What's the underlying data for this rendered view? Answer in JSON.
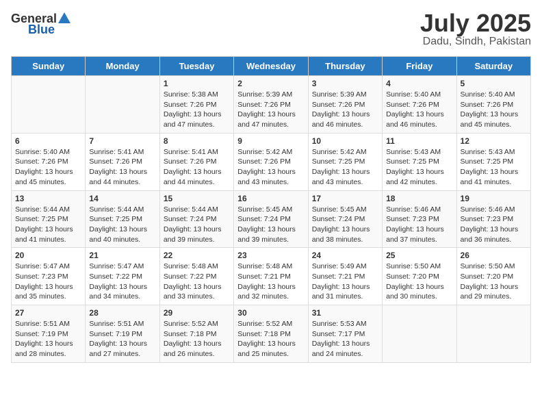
{
  "logo": {
    "general": "General",
    "blue": "Blue"
  },
  "title": "July 2025",
  "subtitle": "Dadu, Sindh, Pakistan",
  "weekdays": [
    "Sunday",
    "Monday",
    "Tuesday",
    "Wednesday",
    "Thursday",
    "Friday",
    "Saturday"
  ],
  "weeks": [
    [
      {
        "day": "",
        "info": ""
      },
      {
        "day": "",
        "info": ""
      },
      {
        "day": "1",
        "sunrise": "5:38 AM",
        "sunset": "7:26 PM",
        "daylight": "13 hours and 47 minutes."
      },
      {
        "day": "2",
        "sunrise": "5:39 AM",
        "sunset": "7:26 PM",
        "daylight": "13 hours and 47 minutes."
      },
      {
        "day": "3",
        "sunrise": "5:39 AM",
        "sunset": "7:26 PM",
        "daylight": "13 hours and 46 minutes."
      },
      {
        "day": "4",
        "sunrise": "5:40 AM",
        "sunset": "7:26 PM",
        "daylight": "13 hours and 46 minutes."
      },
      {
        "day": "5",
        "sunrise": "5:40 AM",
        "sunset": "7:26 PM",
        "daylight": "13 hours and 45 minutes."
      }
    ],
    [
      {
        "day": "6",
        "sunrise": "5:40 AM",
        "sunset": "7:26 PM",
        "daylight": "13 hours and 45 minutes."
      },
      {
        "day": "7",
        "sunrise": "5:41 AM",
        "sunset": "7:26 PM",
        "daylight": "13 hours and 44 minutes."
      },
      {
        "day": "8",
        "sunrise": "5:41 AM",
        "sunset": "7:26 PM",
        "daylight": "13 hours and 44 minutes."
      },
      {
        "day": "9",
        "sunrise": "5:42 AM",
        "sunset": "7:26 PM",
        "daylight": "13 hours and 43 minutes."
      },
      {
        "day": "10",
        "sunrise": "5:42 AM",
        "sunset": "7:25 PM",
        "daylight": "13 hours and 43 minutes."
      },
      {
        "day": "11",
        "sunrise": "5:43 AM",
        "sunset": "7:25 PM",
        "daylight": "13 hours and 42 minutes."
      },
      {
        "day": "12",
        "sunrise": "5:43 AM",
        "sunset": "7:25 PM",
        "daylight": "13 hours and 41 minutes."
      }
    ],
    [
      {
        "day": "13",
        "sunrise": "5:44 AM",
        "sunset": "7:25 PM",
        "daylight": "13 hours and 41 minutes."
      },
      {
        "day": "14",
        "sunrise": "5:44 AM",
        "sunset": "7:25 PM",
        "daylight": "13 hours and 40 minutes."
      },
      {
        "day": "15",
        "sunrise": "5:44 AM",
        "sunset": "7:24 PM",
        "daylight": "13 hours and 39 minutes."
      },
      {
        "day": "16",
        "sunrise": "5:45 AM",
        "sunset": "7:24 PM",
        "daylight": "13 hours and 39 minutes."
      },
      {
        "day": "17",
        "sunrise": "5:45 AM",
        "sunset": "7:24 PM",
        "daylight": "13 hours and 38 minutes."
      },
      {
        "day": "18",
        "sunrise": "5:46 AM",
        "sunset": "7:23 PM",
        "daylight": "13 hours and 37 minutes."
      },
      {
        "day": "19",
        "sunrise": "5:46 AM",
        "sunset": "7:23 PM",
        "daylight": "13 hours and 36 minutes."
      }
    ],
    [
      {
        "day": "20",
        "sunrise": "5:47 AM",
        "sunset": "7:23 PM",
        "daylight": "13 hours and 35 minutes."
      },
      {
        "day": "21",
        "sunrise": "5:47 AM",
        "sunset": "7:22 PM",
        "daylight": "13 hours and 34 minutes."
      },
      {
        "day": "22",
        "sunrise": "5:48 AM",
        "sunset": "7:22 PM",
        "daylight": "13 hours and 33 minutes."
      },
      {
        "day": "23",
        "sunrise": "5:48 AM",
        "sunset": "7:21 PM",
        "daylight": "13 hours and 32 minutes."
      },
      {
        "day": "24",
        "sunrise": "5:49 AM",
        "sunset": "7:21 PM",
        "daylight": "13 hours and 31 minutes."
      },
      {
        "day": "25",
        "sunrise": "5:50 AM",
        "sunset": "7:20 PM",
        "daylight": "13 hours and 30 minutes."
      },
      {
        "day": "26",
        "sunrise": "5:50 AM",
        "sunset": "7:20 PM",
        "daylight": "13 hours and 29 minutes."
      }
    ],
    [
      {
        "day": "27",
        "sunrise": "5:51 AM",
        "sunset": "7:19 PM",
        "daylight": "13 hours and 28 minutes."
      },
      {
        "day": "28",
        "sunrise": "5:51 AM",
        "sunset": "7:19 PM",
        "daylight": "13 hours and 27 minutes."
      },
      {
        "day": "29",
        "sunrise": "5:52 AM",
        "sunset": "7:18 PM",
        "daylight": "13 hours and 26 minutes."
      },
      {
        "day": "30",
        "sunrise": "5:52 AM",
        "sunset": "7:18 PM",
        "daylight": "13 hours and 25 minutes."
      },
      {
        "day": "31",
        "sunrise": "5:53 AM",
        "sunset": "7:17 PM",
        "daylight": "13 hours and 24 minutes."
      },
      {
        "day": "",
        "info": ""
      },
      {
        "day": "",
        "info": ""
      }
    ]
  ]
}
